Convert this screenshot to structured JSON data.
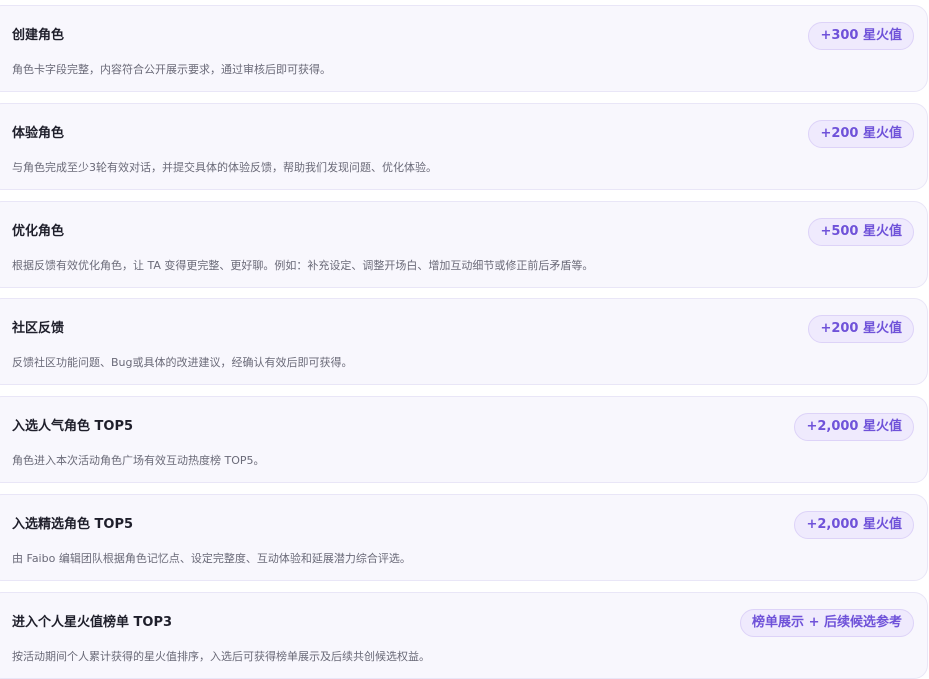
{
  "tasks": [
    {
      "title": "创建角色",
      "desc": "角色卡字段完整，内容符合公开展示要求，通过审核后即可获得。",
      "reward": "+300 星火值"
    },
    {
      "title": "体验角色",
      "desc": "与角色完成至少3轮有效对话，并提交具体的体验反馈，帮助我们发现问题、优化体验。",
      "reward": "+200 星火值"
    },
    {
      "title": "优化角色",
      "desc": "根据反馈有效优化角色，让 TA 变得更完整、更好聊。例如：补充设定、调整开场白、增加互动细节或修正前后矛盾等。",
      "reward": "+500 星火值"
    },
    {
      "title": "社区反馈",
      "desc": "反馈社区功能问题、Bug或具体的改进建议，经确认有效后即可获得。",
      "reward": "+200 星火值"
    },
    {
      "title": "入选人气角色 TOP5",
      "desc": "角色进入本次活动角色广场有效互动热度榜 TOP5。",
      "reward": "+2,000 星火值"
    },
    {
      "title": "入选精选角色 TOP5",
      "desc": "由 Faibo 编辑团队根据角色记忆点、设定完整度、互动体验和延展潜力综合评选。",
      "reward": "+2,000 星火值"
    },
    {
      "title": "进入个人星火值榜单 TOP3",
      "desc": "按活动期间个人累计获得的星火值排序，入选后可获得榜单展示及后续共创候选权益。",
      "reward": "榜单展示 + 后续候选参考"
    }
  ]
}
